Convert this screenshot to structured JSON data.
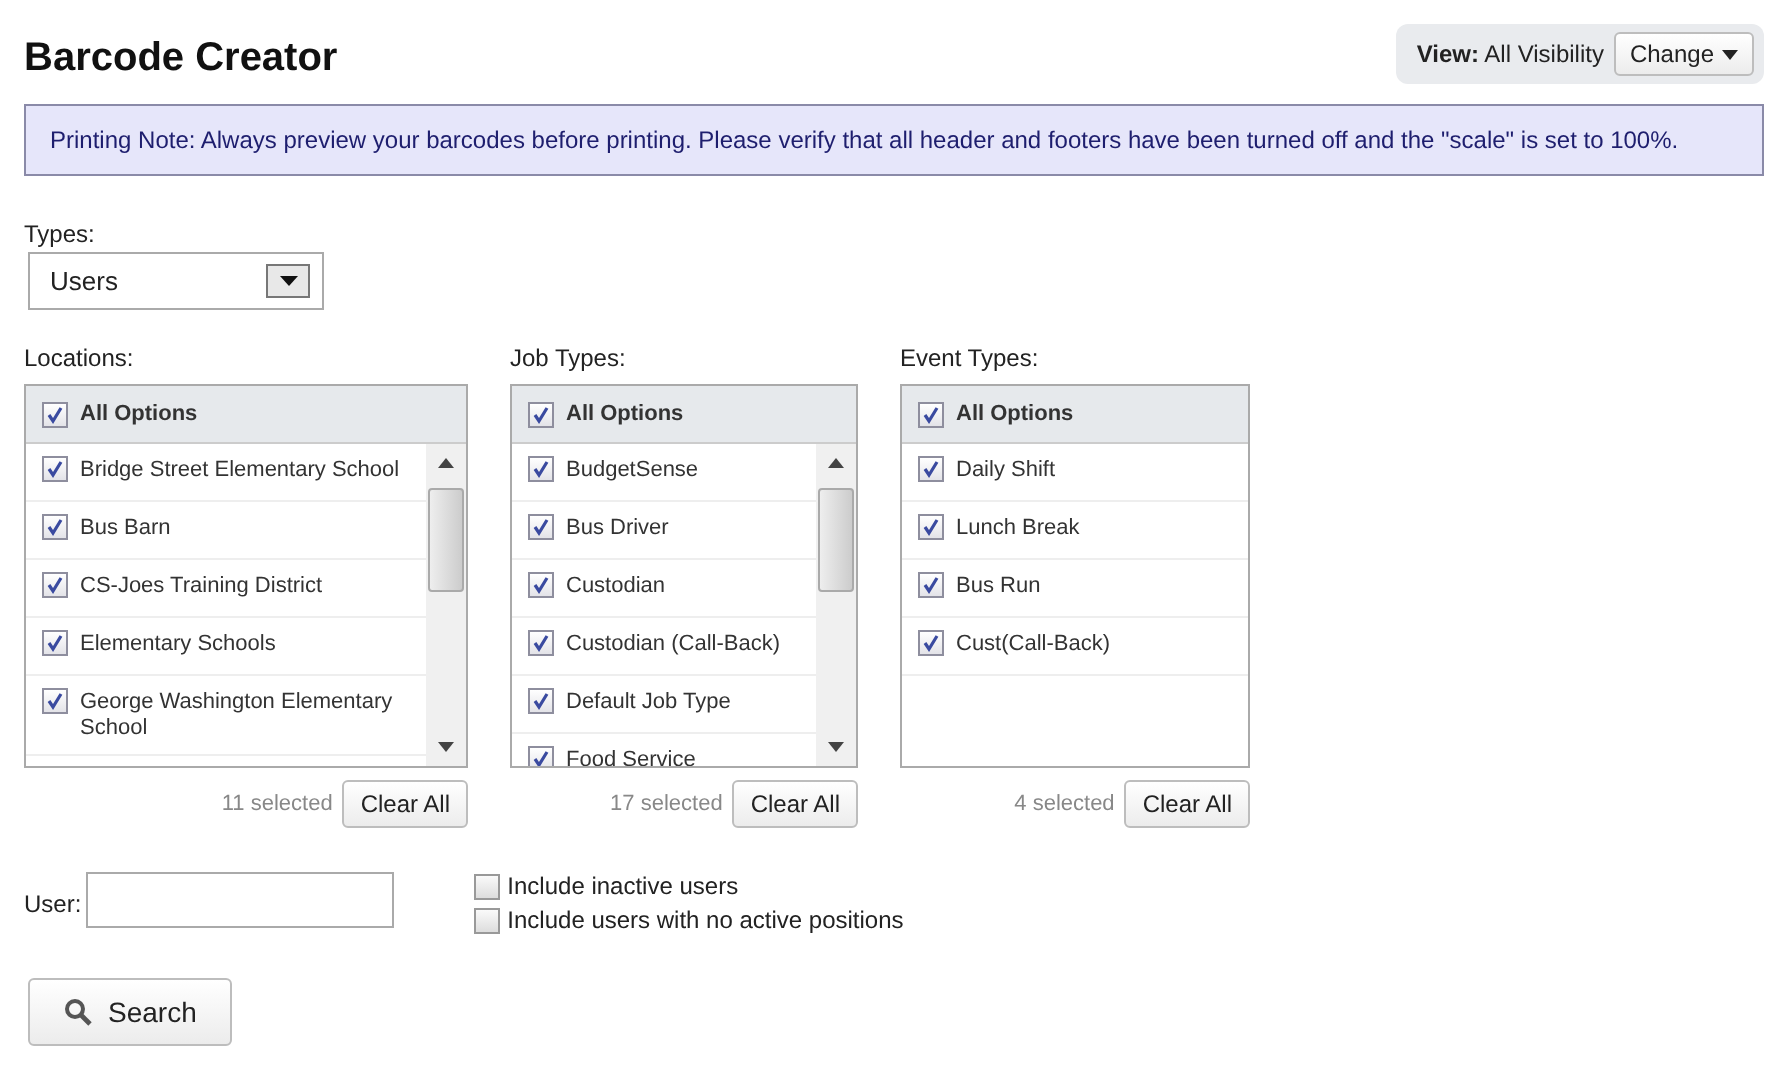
{
  "title": "Barcode Creator",
  "view": {
    "label": "View:",
    "value": "All Visibility",
    "button": "Change"
  },
  "note": "Printing Note: Always preview your barcodes before printing. Please verify that all header and footers have been turned off and the \"scale\" is set to 100%.",
  "types": {
    "label": "Types:",
    "value": "Users"
  },
  "lists": [
    {
      "label": "Locations:",
      "all": {
        "label": "All Options",
        "checked": true
      },
      "scrollable": true,
      "count": "11 selected",
      "clear": "Clear All",
      "items": [
        {
          "label": "Bridge Street Elementary School",
          "checked": true
        },
        {
          "label": "Bus Barn",
          "checked": true
        },
        {
          "label": "CS-Joes Training District",
          "checked": true
        },
        {
          "label": "Elementary Schools",
          "checked": true
        },
        {
          "label": "George Washington Elementary School",
          "checked": true
        }
      ]
    },
    {
      "label": "Job Types:",
      "all": {
        "label": "All Options",
        "checked": true
      },
      "scrollable": true,
      "count": "17 selected",
      "clear": "Clear All",
      "items": [
        {
          "label": "BudgetSense",
          "checked": true
        },
        {
          "label": "Bus Driver",
          "checked": true
        },
        {
          "label": "Custodian",
          "checked": true
        },
        {
          "label": "Custodian (Call-Back)",
          "checked": true
        },
        {
          "label": "Default Job Type",
          "checked": true
        },
        {
          "label": "Food Service",
          "checked": true
        }
      ]
    },
    {
      "label": "Event Types:",
      "all": {
        "label": "All Options",
        "checked": true
      },
      "scrollable": false,
      "count": "4 selected",
      "clear": "Clear All",
      "items": [
        {
          "label": "Daily Shift",
          "checked": true
        },
        {
          "label": "Lunch Break",
          "checked": true
        },
        {
          "label": "Bus Run",
          "checked": true
        },
        {
          "label": "Cust(Call-Back)",
          "checked": true
        }
      ]
    }
  ],
  "user": {
    "label": "User:"
  },
  "options": [
    {
      "label": "Include inactive users",
      "checked": false
    },
    {
      "label": "Include users with no active positions",
      "checked": false
    }
  ],
  "search": "Search"
}
